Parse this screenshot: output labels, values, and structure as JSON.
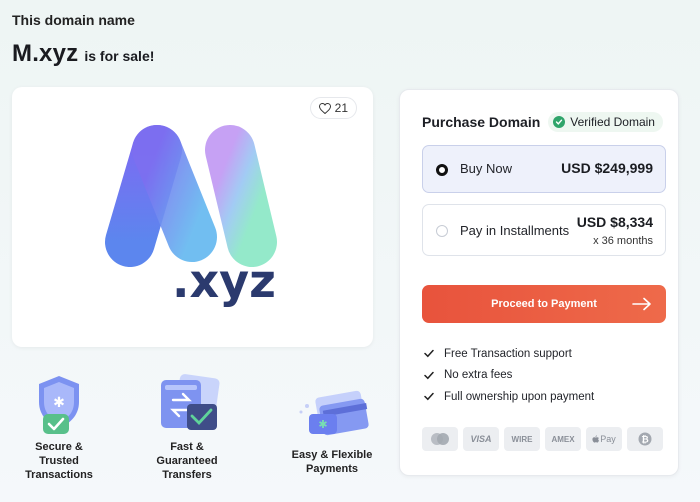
{
  "header": {
    "eyebrow": "This domain name",
    "domain": "M.xyz",
    "suffix": "is for sale!"
  },
  "logo_card": {
    "likes_icon": "heart-icon",
    "likes_count": "21",
    "logo_text": ".xyz",
    "logo_letter": "M"
  },
  "features": [
    {
      "icon": "shield-check-icon",
      "label_lines": [
        "Secure &",
        "Trusted",
        "Transactions"
      ]
    },
    {
      "icon": "fast-transfer-icon",
      "label_lines": [
        "Fast &",
        "Guaranteed",
        "Transfers"
      ]
    },
    {
      "icon": "credit-card-icon",
      "label_lines": [
        "Easy & Flexible",
        "Payments"
      ]
    }
  ],
  "panel": {
    "title": "Purchase Domain",
    "verified_label": "Verified Domain",
    "options": [
      {
        "label": "Buy Now",
        "price": "USD $249,999",
        "selected": true
      },
      {
        "label": "Pay in Installments",
        "price": "USD $8,334",
        "sub": "x 36 months",
        "selected": false
      }
    ],
    "cta_label": "Proceed to Payment",
    "benefits": [
      "Free Transaction support",
      "No extra fees",
      "Full ownership upon payment"
    ],
    "payment_methods": [
      "mastercard",
      "VISA",
      "WIRE",
      "AMEX",
      "Apple Pay",
      "bitcoin"
    ],
    "payment_labels": {
      "visa": "VISA",
      "wire": "WIRE",
      "amex": "AMEX",
      "applepay": "Pay"
    }
  },
  "colors": {
    "accent": "#e8533c",
    "verified": "#2fa46a",
    "logo_text": "#2b3a6e",
    "selected_bg": "#eef1fb"
  }
}
